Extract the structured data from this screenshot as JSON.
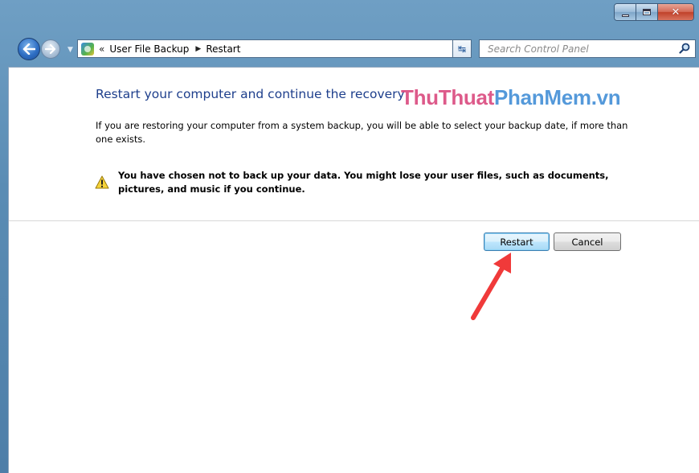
{
  "window": {
    "controls": {
      "minimize": "minimize",
      "maximize": "maximize",
      "close": "close"
    }
  },
  "address_bar": {
    "overflow_glyph": "«",
    "breadcrumbs": [
      "User File Backup",
      "Restart"
    ]
  },
  "search": {
    "placeholder": "Search Control Panel"
  },
  "content": {
    "heading": "Restart your computer and continue the recovery",
    "description": "If you are restoring your computer from a system backup, you will be able to select your backup date, if more than one exists.",
    "warning": "You have chosen not to back up your data. You might lose your user files, such as documents, pictures, and music if you continue."
  },
  "watermark": {
    "part1": "ThuThuat",
    "part2": "PhanMem",
    "part3": ".vn"
  },
  "buttons": {
    "restart": "Restart",
    "cancel": "Cancel"
  },
  "colors": {
    "heading": "#1e3f8c",
    "annotation_arrow": "#f03a3a",
    "window_frame": "#5a8cb4"
  },
  "icons": {
    "back": "back-arrow-icon",
    "forward": "forward-arrow-icon",
    "warning": "warning-icon",
    "search": "search-icon",
    "control_panel": "control-panel-icon"
  }
}
